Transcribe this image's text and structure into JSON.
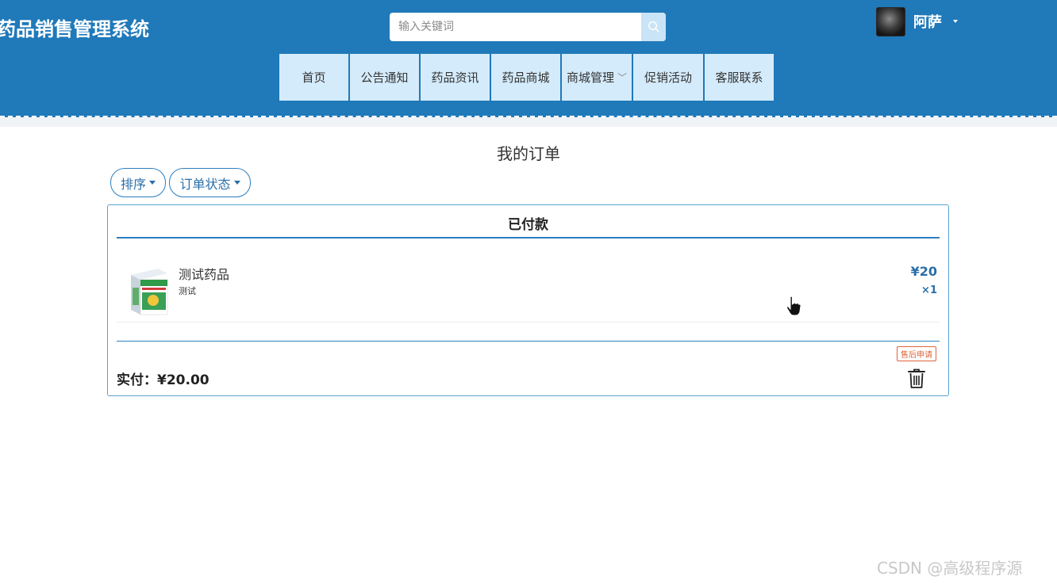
{
  "header": {
    "app_title": "药品销售管理系统",
    "search_placeholder": "输入关键词",
    "search_value": "",
    "username": "阿萨",
    "colors": {
      "header_bg": "#2079b9",
      "nav_bg": "#d4ebfb"
    }
  },
  "nav": {
    "items": [
      {
        "label": "首页"
      },
      {
        "label": "公告通知"
      },
      {
        "label": "药品资讯"
      },
      {
        "label": "药品商城"
      },
      {
        "label": "商城管理",
        "has_dropdown": true
      },
      {
        "label": "促销活动"
      },
      {
        "label": "客服联系"
      }
    ]
  },
  "main": {
    "page_title": "我的订单",
    "filters": {
      "sort_label": "排序",
      "status_label": "订单状态"
    },
    "order": {
      "status": "已付款",
      "item": {
        "name": "测试药品",
        "desc": "测试",
        "price": "¥20",
        "qty": "×1"
      },
      "after_sale_label": "售后申请",
      "paid_total": "实付：¥20.00"
    }
  },
  "icons": {
    "search": "search-icon",
    "caret": "caret-down-icon",
    "chevron": "chevron-down-icon",
    "trash": "trash-icon",
    "cursor": "hand-pointer-icon"
  },
  "watermark": "CSDN @高级程序源"
}
